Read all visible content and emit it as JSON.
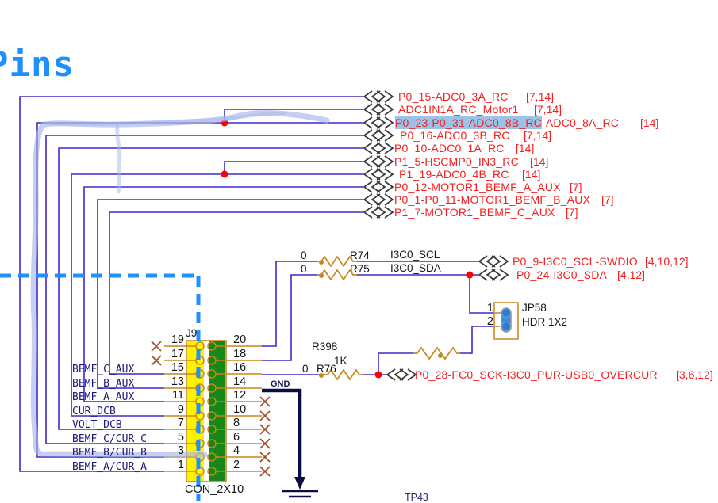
{
  "title": "Pins",
  "nets": [
    {
      "label": "P0_15-ADC0_3A_RC",
      "ref": "[7,14]"
    },
    {
      "label": "ADC1IN1A_RC_Motor1",
      "ref": "[7,14]"
    },
    {
      "label_hl": "P0_23-P0_31-ADC0_8B_RC",
      "label_rest": "-ADC0_8A_RC",
      "ref": "[14]"
    },
    {
      "label": "P0_16-ADC0_3B_RC",
      "ref": "[7,14]"
    },
    {
      "label": "P0_10-ADC0_1A_RC",
      "ref": "[14]"
    },
    {
      "label": "P1_5-HSCMP0_IN3_RC",
      "ref": "[14]"
    },
    {
      "label": "P1_19-ADC0_4B_RC",
      "ref": "[14]"
    },
    {
      "label": "P0_12-MOTOR1_BEMF_A_AUX",
      "ref": "[7]"
    },
    {
      "label": "P0_1-P0_11-MOTOR1_BEMF_B_AUX",
      "ref": "[7]"
    },
    {
      "label": "P1_7-MOTOR1_BEMF_C_AUX",
      "ref": "[7]"
    }
  ],
  "i3c": {
    "scl": "I3C0_SCL",
    "sda": "I3C0_SDA",
    "r74_ref": "R74",
    "r74_val": "0",
    "r75_ref": "R75",
    "r75_val": "0",
    "p0_9": {
      "label": "P0_9-I3C0_SCL-SWDIO",
      "ref": "[4,10,12]"
    },
    "p0_24": {
      "label": "P0_24-I3C0_SDA",
      "ref": "[4,12]"
    }
  },
  "jumper": {
    "refdes": "JP58",
    "part": "HDR 1X2",
    "pin1": "1",
    "pin2": "2"
  },
  "r398": {
    "refdes": "R398",
    "value": "1K"
  },
  "r76": {
    "refdes": "R76",
    "value": "0"
  },
  "p0_28": {
    "label": "P0_28-FC0_SCK-I3C0_PUR-USB0_OVERCUR",
    "ref": "[3,6,12]"
  },
  "connector": {
    "refdes": "J9",
    "part": "CON_2X10",
    "left_pins": [
      "19",
      "17",
      "15",
      "13",
      "11",
      "9",
      "7",
      "5",
      "3",
      "1"
    ],
    "right_pins": [
      "20",
      "18",
      "16",
      "14",
      "12",
      "10",
      "8",
      "6",
      "4",
      "2"
    ],
    "left_labels": [
      "BEMF_C_AUX",
      "BEMF_B_AUX",
      "BEMF_A_AUX",
      "CUR_DCB",
      "VOLT_DCB",
      "BEMF_C/CUR_C",
      "BEMF_B/CUR_B",
      "BEMF_A/CUR_A"
    ]
  },
  "gnd_label": "GND",
  "testpoint": "TP43",
  "colors": {
    "wire": "#4128c8",
    "net_text": "#f51f1f",
    "symbol": "#c8861e",
    "no_connect": "#a34d2a",
    "gnd_wire": "#0b0b46",
    "highlight": "#9cc3e7",
    "connector_yellow": "#fff200",
    "connector_green": "#178717",
    "selection_dash": "#1e90ff",
    "annotation": "#a9b5e8",
    "junction": "#ff0000",
    "jumper_pin": "#2f8fe8",
    "title_blue": "#1e8fff"
  }
}
